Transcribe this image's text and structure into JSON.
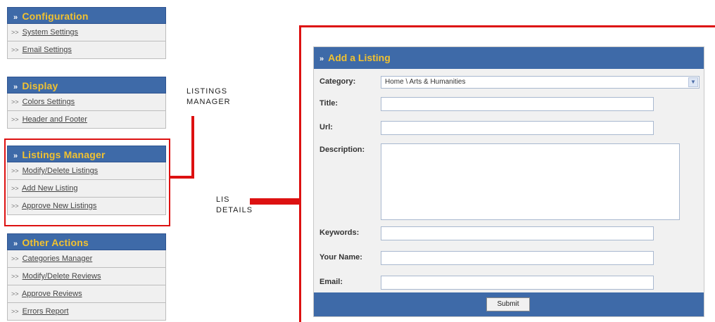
{
  "sidebar": {
    "arrow": "»",
    "item_prefix": ">>",
    "sections": [
      {
        "title": "Configuration",
        "items": [
          "System Settings",
          "Email Settings"
        ]
      },
      {
        "title": "Display",
        "items": [
          "Colors Settings",
          "Header and Footer"
        ]
      },
      {
        "title": "Listings Manager",
        "items": [
          "Modify/Delete Listings",
          "Add New Listing",
          "Approve New Listings"
        ]
      },
      {
        "title": "Other Actions",
        "items": [
          "Categories Manager",
          "Modify/Delete Reviews",
          "Approve Reviews",
          "Errors Report"
        ]
      }
    ]
  },
  "annotations": {
    "listings_manager": [
      "LISTINGS",
      "MANAGER"
    ],
    "listing_details": [
      "LIS",
      "DETAILS"
    ]
  },
  "form": {
    "title": "Add a Listing",
    "category_label": "Category:",
    "category_value": "Home \\ Arts & Humanities",
    "title_label": "Title:",
    "url_label": "Url:",
    "description_label": "Description:",
    "keywords_label": "Keywords:",
    "name_label": "Your Name:",
    "email_label": "Email:",
    "submit_label": "Submit"
  },
  "colors": {
    "header_blue": "#3e6aa8",
    "header_text": "#f2c230",
    "annotation_red": "#dd1111"
  },
  "icons": {
    "section_arrow": "double-arrow-icon",
    "select_dropdown": "chevron-down-icon"
  }
}
